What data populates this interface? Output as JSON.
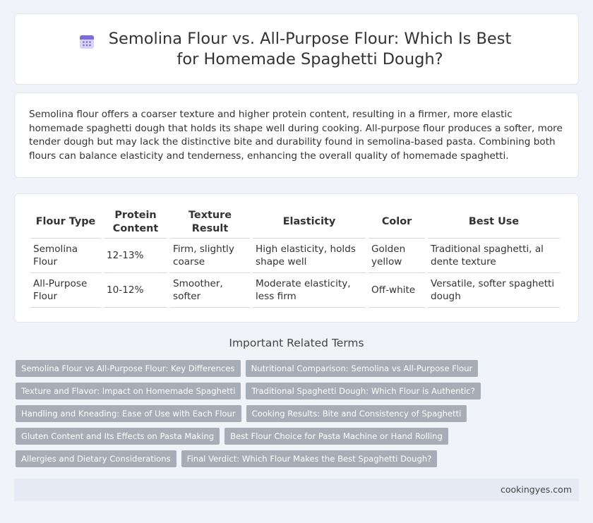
{
  "header": {
    "title": "Semolina Flour vs. All-Purpose Flour: Which Is Best for Homemade Spaghetti Dough?",
    "icon": "calendar-icon"
  },
  "intro": {
    "text": "Semolina flour offers a coarser texture and higher protein content, resulting in a firmer, more elastic homemade spaghetti dough that holds its shape well during cooking. All-purpose flour produces a softer, more tender dough but may lack the distinctive bite and durability found in semolina-based pasta. Combining both flours can balance elasticity and tenderness, enhancing the overall quality of homemade spaghetti."
  },
  "table": {
    "headers": [
      "Flour Type",
      "Protein Content",
      "Texture Result",
      "Elasticity",
      "Color",
      "Best Use"
    ],
    "rows": [
      [
        "Semolina Flour",
        "12-13%",
        "Firm, slightly coarse",
        "High elasticity, holds shape well",
        "Golden yellow",
        "Traditional spaghetti, al dente texture"
      ],
      [
        "All-Purpose Flour",
        "10-12%",
        "Smoother, softer",
        "Moderate elasticity, less firm",
        "Off-white",
        "Versatile, softer spaghetti dough"
      ]
    ]
  },
  "related": {
    "heading": "Important Related Terms",
    "tags": [
      "Semolina Flour vs All-Purpose Flour: Key Differences",
      "Nutritional Comparison: Semolina vs All-Purpose Flour",
      "Texture and Flavor: Impact on Homemade Spaghetti",
      "Traditional Spaghetti Dough: Which Flour is Authentic?",
      "Handling and Kneading: Ease of Use with Each Flour",
      "Cooking Results: Bite and Consistency of Spaghetti",
      "Gluten Content and Its Effects on Pasta Making",
      "Best Flour Choice for Pasta Machine or Hand Rolling",
      "Allergies and Dietary Considerations",
      "Final Verdict: Which Flour Makes the Best Spaghetti Dough?"
    ]
  },
  "footer": {
    "site": "cookingyes.com"
  },
  "colors": {
    "background": "#f0f3f8",
    "tag": "#a7adb6",
    "icon_accent": "#7b6cd9",
    "footer": "#e5eaf4"
  }
}
